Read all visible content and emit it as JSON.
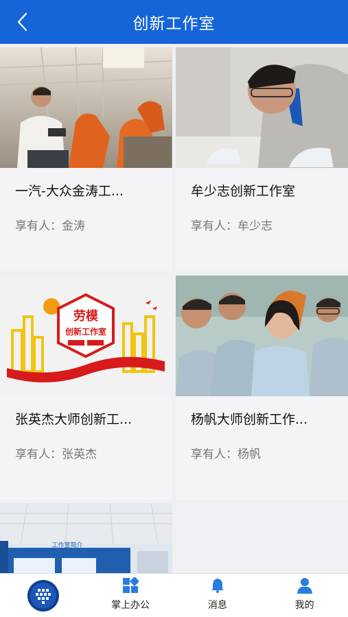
{
  "header": {
    "title": "创新工作室"
  },
  "owner_prefix": "享有人：",
  "cards": [
    {
      "title": "一汽-大众金涛工...",
      "owner": "金涛"
    },
    {
      "title": "牟少志创新工作室",
      "owner": "牟少志"
    },
    {
      "title": "张英杰大师创新工...",
      "owner": "张英杰"
    },
    {
      "title": "杨帆大师创新工作...",
      "owner": "杨帆"
    },
    {
      "title": "",
      "owner": ""
    }
  ],
  "image_texts": {
    "model_worker": "劳模",
    "studio": "创新工作室",
    "intro": "工作室简介"
  },
  "tabbar": {
    "items": [
      {
        "label": ""
      },
      {
        "label": "掌上办公"
      },
      {
        "label": "消息"
      },
      {
        "label": "我的"
      }
    ]
  },
  "colors": {
    "primary": "#1565d8",
    "background": "#efeff4"
  }
}
